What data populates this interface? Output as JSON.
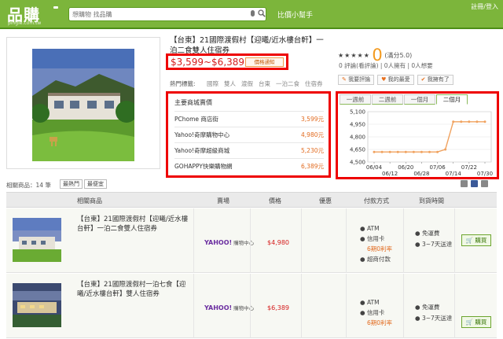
{
  "header": {
    "logo": "品購",
    "logo_sub": "pingle.com.tw",
    "search_placeholder": "想購物 找品購",
    "compare_link": "比價小幫手",
    "login_link": "註冊/登入"
  },
  "product": {
    "title": "【台東】21國際渡假村【迎曦/近水樓台軒】一泊二食雙人住宿券",
    "price_range": "$3,599~$6,389",
    "price_notify": "價格通知",
    "tags_label": "熱門標籤:",
    "tags": [
      "國際",
      "雙人",
      "渡假",
      "台東",
      "一泊二食",
      "住宿券"
    ]
  },
  "sellers": {
    "title": "主要商城賣價",
    "items": [
      {
        "name": "PChome 商店街",
        "price": "3,599元"
      },
      {
        "name": "Yahoo!奇摩購物中心",
        "price": "4,980元"
      },
      {
        "name": "Yahoo!奇摩超級商城",
        "price": "5,230元"
      },
      {
        "name": "GOHAPPY快樂購物網",
        "price": "6,389元"
      }
    ]
  },
  "rating": {
    "stars": "★★★★★",
    "score": "0",
    "score_note": "(滿分5.0)",
    "stats": "0 評論(看評論) | 0人擁有 | 0人想要",
    "actions": [
      "我要評論",
      "我的最愛",
      "我擁有了"
    ]
  },
  "chart_tabs": [
    "一週前",
    "二週前",
    "一個月",
    "二個月"
  ],
  "chart_data": {
    "type": "line",
    "x": [
      "06/04",
      "06/08",
      "06/12",
      "06/16",
      "06/20",
      "06/24",
      "06/28",
      "07/02",
      "07/06",
      "07/10",
      "07/14",
      "07/18",
      "07/22",
      "07/26",
      "07/30"
    ],
    "xticks_top": [
      "06/04",
      "06/20",
      "07/06",
      "07/22"
    ],
    "xticks_bottom": [
      "06/12",
      "06/28",
      "07/14",
      "07/30"
    ],
    "series": [
      {
        "values": [
          4620,
          4620,
          4620,
          4620,
          4620,
          4620,
          4620,
          4620,
          4620,
          4650,
          4980,
          4980,
          4980,
          4980,
          4980
        ]
      }
    ],
    "yticks": [
      "5,100",
      "4,950",
      "4,800",
      "4,650",
      "4,500"
    ],
    "ylim": [
      4500,
      5100
    ],
    "grid": true,
    "line_color": "#f0a25f"
  },
  "listing": {
    "count_text": "相關商品：14 筆",
    "sort_options": [
      "最熱門",
      "最便宜"
    ],
    "columns": [
      "相關商品",
      "賣場",
      "價格",
      "優惠",
      "付款方式",
      "到貨時間"
    ],
    "rows": [
      {
        "title": "【台東】21國際渡假村【迎曦/近水樓台軒】一泊二食雙人住宿券",
        "store_logo": "YAHOO!",
        "store_sub": "購物中心",
        "price": "$4,980",
        "payments": [
          "ATM",
          "信用卡",
          "6期0利率",
          "超商付款"
        ],
        "shipping": [
          "免運費",
          "3~7天送達"
        ],
        "buy_label": "購買"
      },
      {
        "title": "【台東】21國際渡假村一泊七食【迎曦/近水樓台軒】雙人住宿券",
        "store_logo": "YAHOO!",
        "store_sub": "購物中心",
        "price": "$6,389",
        "payments": [
          "ATM",
          "信用卡",
          "6期0利率"
        ],
        "shipping": [
          "免運費",
          "3~7天送達"
        ],
        "buy_label": "購買"
      }
    ]
  }
}
